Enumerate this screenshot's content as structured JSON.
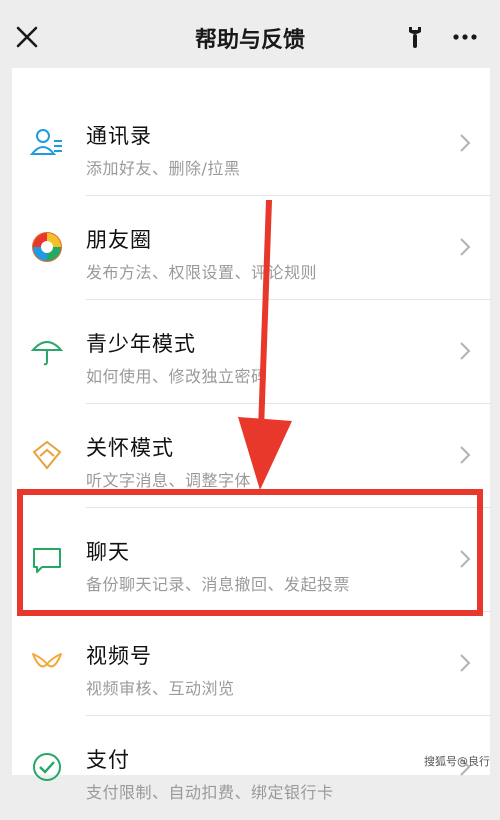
{
  "header": {
    "title": "帮助与反馈",
    "close_icon": "close-icon",
    "tool_icon": "wrench-icon",
    "more_icon": "more-icon"
  },
  "items": [
    {
      "title": "通讯录",
      "subtitle": "添加好友、删除/拉黑",
      "icon": "contacts-icon",
      "color": "#1f9be0"
    },
    {
      "title": "朋友圈",
      "subtitle": "发布方法、权限设置、评论规则",
      "icon": "moments-icon",
      "color": "#e86b2a"
    },
    {
      "title": "青少年模式",
      "subtitle": "如何使用、修改独立密码",
      "icon": "umbrella-icon",
      "color": "#2aa66b"
    },
    {
      "title": "关怀模式",
      "subtitle": "听文字消息、调整字体",
      "icon": "care-icon",
      "color": "#e8a23a"
    },
    {
      "title": "聊天",
      "subtitle": "备份聊天记录、消息撤回、发起投票",
      "icon": "chat-icon",
      "color": "#24a865"
    },
    {
      "title": "视频号",
      "subtitle": "视频审核、互动浏览",
      "icon": "channels-icon",
      "color": "#f3a838"
    },
    {
      "title": "支付",
      "subtitle": "支付限制、自动扣费、绑定银行卡",
      "icon": "pay-icon",
      "color": "#24a865"
    }
  ],
  "annotations": {
    "highlight_color": "#e8372b",
    "highlighted_item": "聊天"
  },
  "watermark": "搜狐号@良行"
}
